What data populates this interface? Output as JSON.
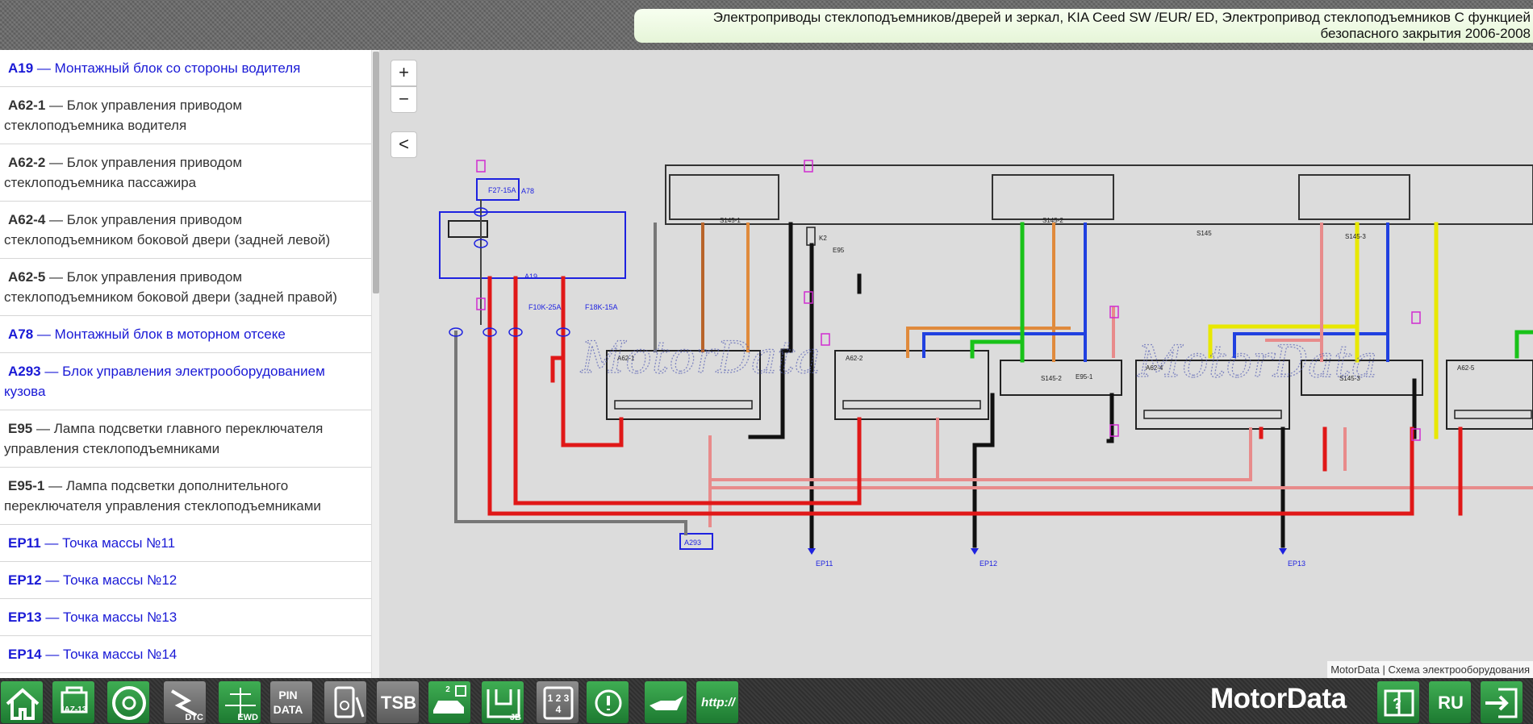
{
  "header": {
    "title": "Электроприводы стеклоподъемников/дверей и зеркал, KIA Ceed SW /EUR/ ED, Электропривод стеклоподъемников С функцией безопасного закрытия 2006-2008"
  },
  "sidebar": {
    "items": [
      {
        "code": "A19",
        "desc": "— Монтажный блок со стороны водителя",
        "link": true
      },
      {
        "code": "A62-1",
        "desc": "— Блок управления приводом стеклоподъемника водителя",
        "link": false
      },
      {
        "code": "A62-2",
        "desc": "— Блок управления приводом стеклоподъемника пассажира",
        "link": false
      },
      {
        "code": "A62-4",
        "desc": "— Блок управления приводом стеклоподъемником боковой двери (задней левой)",
        "link": false
      },
      {
        "code": "A62-5",
        "desc": "— Блок управления приводом стеклоподъемником боковой двери (задней правой)",
        "link": false
      },
      {
        "code": "A78",
        "desc": "— Монтажный блок в моторном отсеке",
        "link": true
      },
      {
        "code": "A293",
        "desc": "— Блок управления электрооборудованием кузова",
        "link": true
      },
      {
        "code": "E95",
        "desc": "— Лампа подсветки главного переключателя управления стеклоподъемниками",
        "link": false
      },
      {
        "code": "E95-1",
        "desc": "— Лампа подсветки дополнительного переключателя управления стеклоподъемниками",
        "link": false
      },
      {
        "code": "EP11",
        "desc": "— Точка массы №11",
        "link": true
      },
      {
        "code": "EP12",
        "desc": "— Точка массы №12",
        "link": true
      },
      {
        "code": "EP13",
        "desc": "— Точка массы №13",
        "link": true
      },
      {
        "code": "EP14",
        "desc": "— Точка массы №14",
        "link": true
      }
    ]
  },
  "map": {
    "zoom_in": "+",
    "zoom_out": "−",
    "collapse": "<",
    "attribution": "MotorData | Схема электрооборудования",
    "watermark": "MotorData"
  },
  "diagram": {
    "labels": {
      "a19": "A19",
      "a78": "A78",
      "a293": "A293",
      "f27": "F27-15A",
      "f10": "F10K-25A",
      "f18": "F18K-15A",
      "a62_1": "A62-1",
      "a62_2": "A62-2",
      "a62_4": "A62-4",
      "a62_5": "A62-5",
      "s145_1": "S145-1",
      "s145_2": "S145-2",
      "s145_3": "S145-3",
      "s145": "S145",
      "e95": "E95",
      "e95_1": "E95-1",
      "k2": "K2",
      "ep11": "EP11",
      "ep12": "EP12",
      "ep13": "EP13"
    }
  },
  "toolbar": {
    "items": [
      {
        "name": "home",
        "label": ""
      },
      {
        "name": "engine",
        "label": "IAZ-13"
      },
      {
        "name": "wheel",
        "label": ""
      },
      {
        "name": "dtc",
        "label": "DTC"
      },
      {
        "name": "ewd",
        "label": "EWD"
      },
      {
        "name": "pin-data",
        "label": "PIN DATA"
      },
      {
        "name": "multimeter",
        "label": ""
      },
      {
        "name": "tsb",
        "label": "TSB"
      },
      {
        "name": "car-lift",
        "label": "2"
      },
      {
        "name": "jb",
        "label": "JB"
      },
      {
        "name": "connector",
        "label": "1 2 3 4"
      },
      {
        "name": "brake-warning",
        "label": ""
      },
      {
        "name": "oil",
        "label": ""
      },
      {
        "name": "http",
        "label": "http://"
      }
    ],
    "brand": "MotorData",
    "help": "",
    "language": "RU",
    "exit": ""
  },
  "colors": {
    "link": "#1a1ad6",
    "toolbar_green": "#2a9a40",
    "title_bg": "#eef9e6"
  }
}
